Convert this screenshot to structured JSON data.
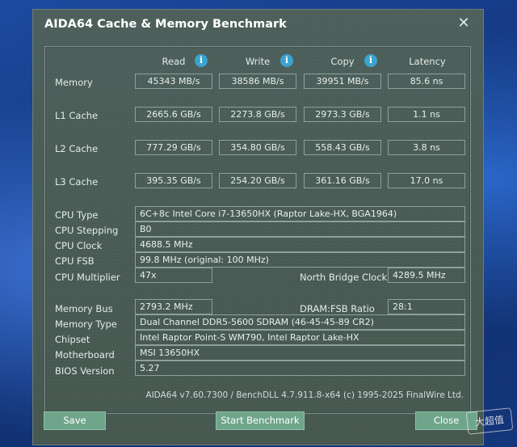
{
  "window": {
    "title": "AIDA64 Cache & Memory Benchmark",
    "close_glyph": "✕"
  },
  "columns": {
    "read": "Read",
    "write": "Write",
    "copy": "Copy",
    "latency": "Latency"
  },
  "info_glyph": "i",
  "rows": [
    {
      "label": "Memory",
      "read": "45343 MB/s",
      "write": "38586 MB/s",
      "copy": "39951 MB/s",
      "latency": "85.6 ns"
    },
    {
      "label": "L1 Cache",
      "read": "2665.6 GB/s",
      "write": "2273.8 GB/s",
      "copy": "2973.3 GB/s",
      "latency": "1.1 ns"
    },
    {
      "label": "L2 Cache",
      "read": "777.29 GB/s",
      "write": "354.80 GB/s",
      "copy": "558.43 GB/s",
      "latency": "3.8 ns"
    },
    {
      "label": "L3 Cache",
      "read": "395.35 GB/s",
      "write": "254.20 GB/s",
      "copy": "361.16 GB/s",
      "latency": "17.0 ns"
    }
  ],
  "cpu": {
    "type_label": "CPU Type",
    "type": "6C+8c Intel Core i7-13650HX  (Raptor Lake-HX, BGA1964)",
    "stepping_label": "CPU Stepping",
    "stepping": "B0",
    "clock_label": "CPU Clock",
    "clock": "4688.5 MHz",
    "fsb_label": "CPU FSB",
    "fsb": "99.8 MHz  (original: 100 MHz)",
    "multiplier_label": "CPU Multiplier",
    "multiplier": "47x",
    "nb_clock_label": "North Bridge Clock",
    "nb_clock": "4289.5 MHz"
  },
  "system": {
    "membus_label": "Memory Bus",
    "membus": "2793.2 MHz",
    "ratio_label": "DRAM:FSB Ratio",
    "ratio": "28:1",
    "memtype_label": "Memory Type",
    "memtype": "Dual Channel DDR5-5600 SDRAM  (46-45-45-89 CR2)",
    "chipset_label": "Chipset",
    "chipset": "Intel Raptor Point-S WM790, Intel Raptor Lake-HX",
    "motherboard_label": "Motherboard",
    "motherboard": "MSI 13650HX",
    "bios_label": "BIOS Version",
    "bios": "5.27"
  },
  "footer": "AIDA64 v7.60.7300 / BenchDLL 4.7.911.8-x64  (c) 1995-2025 FinalWire Ltd.",
  "buttons": {
    "save": "Save",
    "start": "Start Benchmark",
    "close": "Close"
  },
  "watermark": "大超值"
}
